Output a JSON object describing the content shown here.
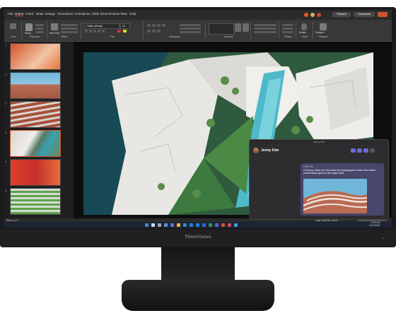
{
  "window": {
    "tabs": [
      "File",
      "Home",
      "Insert",
      "Draw",
      "Design",
      "Transitions",
      "Animations",
      "Slide Show",
      "Review",
      "View",
      "Help"
    ],
    "active_tab": "Home",
    "present_label": "Present",
    "comments_label": "Comments"
  },
  "ribbon": {
    "undo_label": "Undo",
    "paste_label": "Paste",
    "clipboard_group": "Clipboard",
    "new_slide_label": "New Slide",
    "slides_group": "Slides",
    "font_name": "Calibri (Body)",
    "font_size": "12",
    "font_group": "Font",
    "paragraph_group": "Paragraph",
    "drawing_group": "Drawing",
    "editing_group": "Editing",
    "voice_group": "Voice",
    "designer_group": "Designer",
    "dictate_label": "Dictate",
    "designer_label": "Designer"
  },
  "thumbnails": [
    {
      "num": "1",
      "colors": [
        "#d5542a",
        "#f1c4a4"
      ]
    },
    {
      "num": "2",
      "colors": [
        "#b96a52",
        "#6fb6d9"
      ]
    },
    {
      "num": "3",
      "colors": [
        "#a74f3a",
        "#d8d4ce"
      ]
    },
    {
      "num": "4",
      "colors": [
        "#5a7a64",
        "#dcd4c8"
      ]
    },
    {
      "num": "5",
      "colors": [
        "#e0402a",
        "#c4302a"
      ]
    },
    {
      "num": "6",
      "colors": [
        "#5ea24a",
        "#d7ddd7"
      ]
    }
  ],
  "status": {
    "slide_indicator": "Slide 4 of 7",
    "help_improve": "Help Improve Office"
  },
  "taskbar": {
    "time": "11:00 AM",
    "date": "12/12/2022"
  },
  "chat": {
    "window_title": "Jenny Kim",
    "contact_name": "Jenny Kim",
    "message_time": "12:02 PM",
    "message_text": "Hi Jenny, these are the shots the photographer took of the latest residential project on the water front"
  },
  "monitor": {
    "brand": "ThinkVision"
  },
  "colors": {
    "accent": "#d35230",
    "ribbon": "#383838",
    "bubble": "#47476b",
    "taskbar": "#1c2433"
  }
}
